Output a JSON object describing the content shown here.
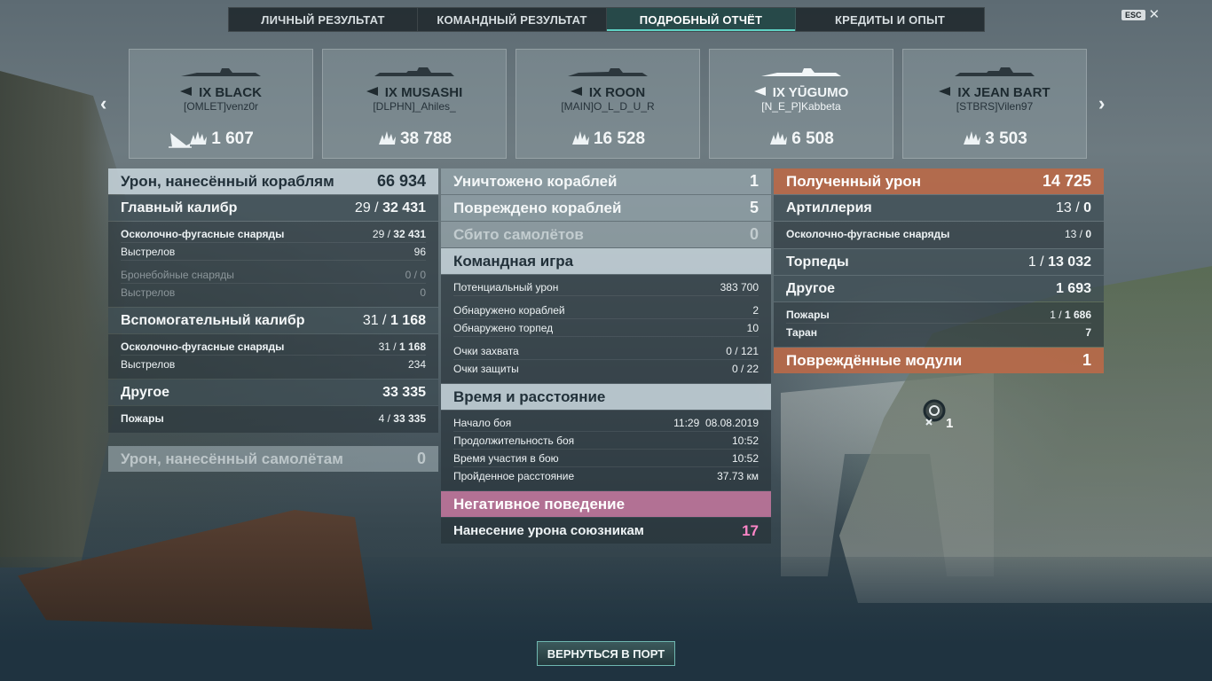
{
  "tabs": [
    {
      "label": "ЛИЧНЫЙ РЕЗУЛЬТАТ"
    },
    {
      "label": "КОМАНДНЫЙ РЕЗУЛЬТАТ"
    },
    {
      "label": "ПОДРОБНЫЙ ОТЧЁТ"
    },
    {
      "label": "КРЕДИТЫ И ОПЫТ"
    }
  ],
  "esc_label": "ESC",
  "ships": [
    {
      "tier_name": "IX BLACK",
      "player": "[OMLET]venz0r",
      "damage": "1 607"
    },
    {
      "tier_name": "IX MUSASHI",
      "player": "[DLPHN]_Ahiles_",
      "damage": "38 788"
    },
    {
      "tier_name": "IX ROON",
      "player": "[MAIN]O_L_D_U_R",
      "damage": "16 528"
    },
    {
      "tier_name": "IX YŪGUMO",
      "player": "[N_E_P]Kabbeta",
      "damage": "6 508"
    },
    {
      "tier_name": "IX JEAN BART",
      "player": "[STBRS]Vilen97",
      "damage": "3 503"
    }
  ],
  "left": {
    "ship_damage": {
      "label": "Урон, нанесённый кораблям",
      "value": "66 934"
    },
    "main_battery": {
      "label": "Главный калибр",
      "hits": "29",
      "total": "32 431"
    },
    "mb_he": {
      "label": "Осколочно-фугасные снаряды",
      "hits": "29",
      "total": "32 431"
    },
    "mb_he_shots": {
      "label": "Выстрелов",
      "value": "96"
    },
    "mb_ap": {
      "label": "Бронебойные снаряды",
      "hits": "0",
      "total": "0"
    },
    "mb_ap_shots": {
      "label": "Выстрелов",
      "value": "0"
    },
    "secondary": {
      "label": "Вспомогательный калибр",
      "hits": "31",
      "total": "1 168"
    },
    "sec_he": {
      "label": "Осколочно-фугасные снаряды",
      "hits": "31",
      "total": "1 168"
    },
    "sec_he_shots": {
      "label": "Выстрелов",
      "value": "234"
    },
    "other": {
      "label": "Другое",
      "value": "33 335"
    },
    "fires": {
      "label": "Пожары",
      "hits": "4",
      "total": "33 335"
    },
    "plane_damage": {
      "label": "Урон, нанесённый самолётам",
      "value": "0"
    }
  },
  "center": {
    "destroyed": {
      "label": "Уничтожено кораблей",
      "value": "1"
    },
    "damaged": {
      "label": "Повреждено кораблей",
      "value": "5"
    },
    "planes": {
      "label": "Сбито самолётов",
      "value": "0"
    },
    "team_play": {
      "label": "Командная игра"
    },
    "potential": {
      "label": "Потенциальный урон",
      "value": "383 700"
    },
    "spotted_ships": {
      "label": "Обнаружено кораблей",
      "value": "2"
    },
    "spotted_torps": {
      "label": "Обнаружено торпед",
      "value": "10"
    },
    "capture": {
      "label": "Очки захвата",
      "value": "0 / 121"
    },
    "defense": {
      "label": "Очки защиты",
      "value": "0 / 22"
    },
    "time_distance": {
      "label": "Время и расстояние"
    },
    "start": {
      "label": "Начало боя",
      "time": "11:29",
      "date": "08.08.2019"
    },
    "duration": {
      "label": "Продолжительность боя",
      "value": "10:52"
    },
    "participation": {
      "label": "Время участия в бою",
      "value": "10:52"
    },
    "distance": {
      "label": "Пройденное расстояние",
      "value": "37.73 км"
    },
    "negative": {
      "label": "Негативное поведение"
    },
    "team_damage": {
      "label": "Нанесение урона союзникам",
      "value": "17"
    }
  },
  "right": {
    "received": {
      "label": "Полученный урон",
      "value": "14 725"
    },
    "artillery": {
      "label": "Артиллерия",
      "hits": "13",
      "total": "0"
    },
    "art_he": {
      "label": "Осколочно-фугасные снаряды",
      "hits": "13",
      "total": "0"
    },
    "torpedoes": {
      "label": "Торпеды",
      "hits": "1",
      "total": "13 032"
    },
    "other": {
      "label": "Другое",
      "value": "1 693"
    },
    "fires": {
      "label": "Пожары",
      "hits": "1",
      "total": "1 686"
    },
    "ram": {
      "label": "Таран",
      "value": "7"
    },
    "modules": {
      "label": "Повреждённые модули",
      "value": "1"
    },
    "module_count": "1"
  },
  "back_button": "ВЕРНУТЬСЯ В ПОРТ",
  "colors": {
    "accent": "#5fd2c4",
    "received_header": "#ba6948",
    "negative_header": "#c878a0",
    "team_damage_value": "#ff86c8"
  }
}
